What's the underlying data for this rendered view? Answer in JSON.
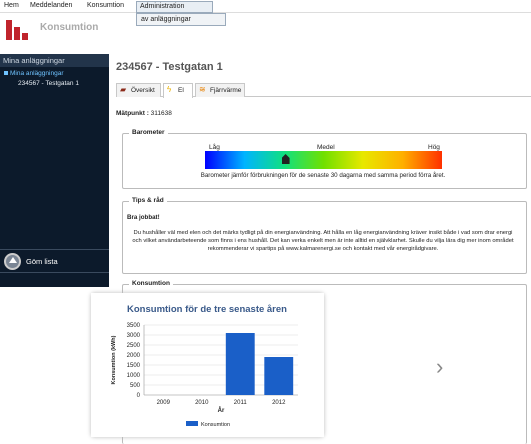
{
  "menu": {
    "items": [
      "Hem",
      "Meddelanden",
      "Konsumtion",
      "Administration"
    ],
    "dropdown_item": "av anläggningar"
  },
  "brand": {
    "name": "Konsumtion",
    "color": "#c0242c"
  },
  "sidebar": {
    "header": "Mina anläggningar",
    "root": "Mina anläggningar",
    "child": "234567 - Testgatan 1",
    "collapse": "Göm lista"
  },
  "page": {
    "title": "234567 - Testgatan 1"
  },
  "tabs": [
    {
      "label": "Översikt",
      "icon": "overview-icon"
    },
    {
      "label": "El",
      "icon": "lightning-icon"
    },
    {
      "label": "Fjärrvärme",
      "icon": "heat-icon"
    }
  ],
  "matpunkt": {
    "label": "Mätpunkt :",
    "value": "311638"
  },
  "barometer": {
    "legend": "Barometer",
    "low": "Låg",
    "mid": "Medel",
    "high": "Hög",
    "caption": "Barometer jämför förbrukningen för de senaste 30 dagarna med samma period förra året.",
    "level": 0.34
  },
  "tips": {
    "legend": "Tips & råd",
    "title": "Bra jobbat!",
    "text": "Du hushåller väl med elen och det märks tydligt på din energianvändning. Att hålla en låg energianvändning kräver insikt både i vad som drar energi och vilket användarbeteende som finns i ens hushåll. Det kan verka enkelt men är inte alltid en självklarhet. Skulle du vilja lära dig mer inom området rekommenderar vi spartips på www.kalmarenergi.se och kontakt med vår energirådgivare."
  },
  "consumption": {
    "legend": "Konsumtion"
  },
  "chart_data": {
    "type": "bar",
    "title": "Konsumtion för de tre senaste åren",
    "categories": [
      "2009",
      "2010",
      "2011",
      "2012"
    ],
    "series": [
      {
        "name": "Konsumtion",
        "values": [
          0,
          0,
          3100,
          1900
        ]
      }
    ],
    "xlabel": "År",
    "ylabel": "Konsumtion (kWh)",
    "yticks": [
      "0",
      "500",
      "1000",
      "1500",
      "2000",
      "2500",
      "3000",
      "3500"
    ],
    "ylim": [
      0,
      3500
    ],
    "grid": true,
    "legend": "bottom",
    "color": "#1a5fc8"
  }
}
